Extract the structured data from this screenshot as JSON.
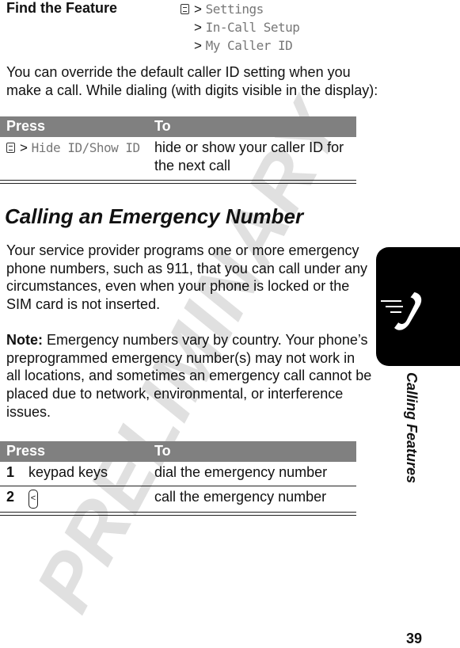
{
  "watermark": "PRELIMINARY",
  "find_feature": {
    "label": "Find the Feature",
    "menu_icon": "menu-key-icon",
    "path": [
      "Settings",
      "In-Call Setup",
      "My Caller ID"
    ]
  },
  "intro": "You can override the default caller ID setting when you make a call. While dialing (with digits visible in the display):",
  "table1": {
    "headers": [
      "Press",
      "To"
    ],
    "rows": [
      {
        "press_prefix_icon": "menu-key-icon",
        "press": "Hide ID/Show ID",
        "to": "hide or show your caller ID for the next call"
      }
    ]
  },
  "section_title": "Calling an Emergency Number",
  "para1": "Your service provider programs one or more emergency phone numbers, such as 911, that you can call under any circumstances, even when your phone is locked or the SIM card is not inserted.",
  "note_label": "Note:",
  "note_text": " Emergency numbers vary by country. Your phone’s preprogrammed emergency number(s) may not work in all locations, and sometimes an emergency call cannot be placed due to network, environmental, or interference issues.",
  "table2": {
    "headers": [
      "Press",
      "To"
    ],
    "rows": [
      {
        "step": "1",
        "press": "keypad keys",
        "to": "dial the emergency number"
      },
      {
        "step": "2",
        "press_icon": "send-key-icon",
        "to": "call the emergency number"
      }
    ]
  },
  "side_tab": {
    "label": "Calling Features",
    "icon": "phone-icon"
  },
  "page_number": "39"
}
